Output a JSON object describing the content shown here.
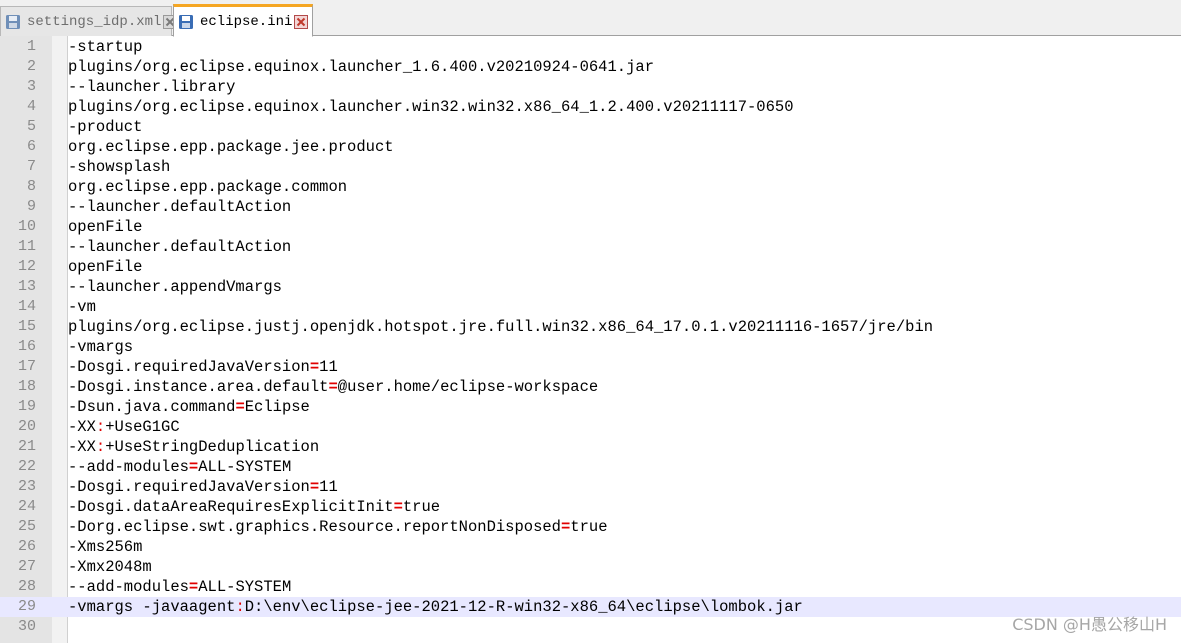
{
  "tabs": [
    {
      "label": "settings_idp.xml",
      "active": false
    },
    {
      "label": "eclipse.ini",
      "active": true
    }
  ],
  "colors": {
    "operator": "#e00000",
    "current_line": "#e8e8ff",
    "line_number": "#8a8a8a",
    "gutter": "#e4e4e4"
  },
  "current_line": 29,
  "lines": [
    [
      {
        "t": "-startup"
      }
    ],
    [
      {
        "t": "plugins/org.eclipse.equinox.launcher_1.6.400.v20210924-0641.jar"
      }
    ],
    [
      {
        "t": "--launcher.library"
      }
    ],
    [
      {
        "t": "plugins/org.eclipse.equinox.launcher.win32.win32.x86_64_1.2.400.v20211117-0650"
      }
    ],
    [
      {
        "t": "-product"
      }
    ],
    [
      {
        "t": "org.eclipse.epp.package.jee.product"
      }
    ],
    [
      {
        "t": "-showsplash"
      }
    ],
    [
      {
        "t": "org.eclipse.epp.package.common"
      }
    ],
    [
      {
        "t": "--launcher.defaultAction"
      }
    ],
    [
      {
        "t": "openFile"
      }
    ],
    [
      {
        "t": "--launcher.defaultAction"
      }
    ],
    [
      {
        "t": "openFile"
      }
    ],
    [
      {
        "t": "--launcher.appendVmargs"
      }
    ],
    [
      {
        "t": "-vm"
      }
    ],
    [
      {
        "t": "plugins/org.eclipse.justj.openjdk.hotspot.jre.full.win32.x86_64_17.0.1.v20211116-1657/jre/bin"
      }
    ],
    [
      {
        "t": "-vmargs"
      }
    ],
    [
      {
        "t": "-Dosgi.requiredJavaVersion"
      },
      {
        "t": "=",
        "c": "eq"
      },
      {
        "t": "11"
      }
    ],
    [
      {
        "t": "-Dosgi.instance.area.default"
      },
      {
        "t": "=",
        "c": "eq"
      },
      {
        "t": "@user.home/eclipse-workspace"
      }
    ],
    [
      {
        "t": "-Dsun.java.command"
      },
      {
        "t": "=",
        "c": "eq"
      },
      {
        "t": "Eclipse"
      }
    ],
    [
      {
        "t": "-XX"
      },
      {
        "t": ":",
        "c": "colon"
      },
      {
        "t": "+UseG1GC"
      }
    ],
    [
      {
        "t": "-XX"
      },
      {
        "t": ":",
        "c": "colon"
      },
      {
        "t": "+UseStringDeduplication"
      }
    ],
    [
      {
        "t": "--add-modules"
      },
      {
        "t": "=",
        "c": "eq"
      },
      {
        "t": "ALL-SYSTEM"
      }
    ],
    [
      {
        "t": "-Dosgi.requiredJavaVersion"
      },
      {
        "t": "=",
        "c": "eq"
      },
      {
        "t": "11"
      }
    ],
    [
      {
        "t": "-Dosgi.dataAreaRequiresExplicitInit"
      },
      {
        "t": "=",
        "c": "eq"
      },
      {
        "t": "true"
      }
    ],
    [
      {
        "t": "-Dorg.eclipse.swt.graphics.Resource.reportNonDisposed"
      },
      {
        "t": "=",
        "c": "eq"
      },
      {
        "t": "true"
      }
    ],
    [
      {
        "t": "-Xms256m"
      }
    ],
    [
      {
        "t": "-Xmx2048m"
      }
    ],
    [
      {
        "t": "--add-modules"
      },
      {
        "t": "=",
        "c": "eq"
      },
      {
        "t": "ALL-SYSTEM"
      }
    ],
    [
      {
        "t": "-vmargs -javaagent"
      },
      {
        "t": ":",
        "c": "colon"
      },
      {
        "t": "D:\\env\\eclipse-jee-2021-12-R-win32-x86_64\\eclipse\\lombok.jar"
      }
    ],
    []
  ],
  "watermark": "CSDN @H愚公移山H"
}
